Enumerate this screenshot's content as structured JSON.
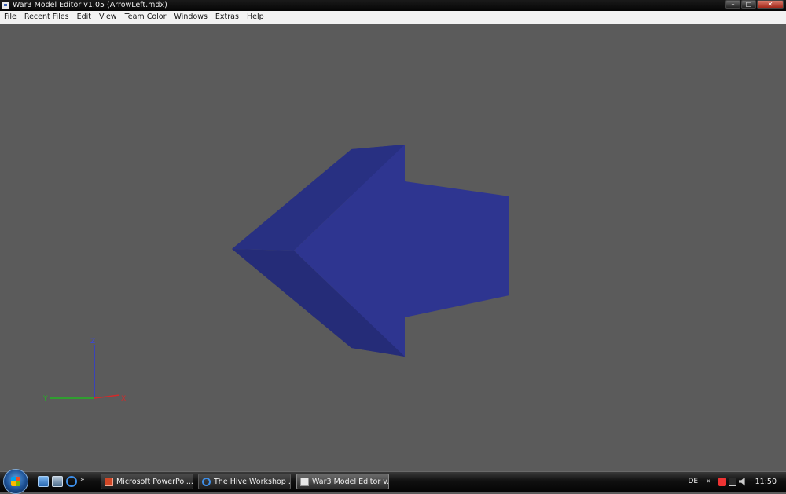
{
  "window": {
    "title": "War3 Model Editor v1.05 (ArrowLeft.mdx)",
    "buttons": {
      "minimize": "–",
      "maximize": "□",
      "close": "✕"
    }
  },
  "menu": {
    "items": [
      "File",
      "Recent Files",
      "Edit",
      "View",
      "Team Color",
      "Windows",
      "Extras",
      "Help"
    ]
  },
  "viewport": {
    "background": "#5b5b5b",
    "model_color": "#2e3590",
    "axes": {
      "z_label": "Z",
      "y_label": "Y",
      "x_label": "X",
      "z_color": "#2f3ad8",
      "y_color": "#22b522",
      "x_color": "#d42a2a"
    }
  },
  "taskbar": {
    "quicklaunch": [
      "show-desktop-icon",
      "switch-windows-icon",
      "internet-explorer-icon"
    ],
    "quicklaunch_more": "»",
    "tasks": [
      {
        "label": "Microsoft PowerPoi...",
        "icon": "powerpoint-icon",
        "active": false
      },
      {
        "label": "The Hive Workshop ...",
        "icon": "internet-explorer-icon",
        "active": false
      },
      {
        "label": "War3 Model Editor v...",
        "icon": "war3-model-editor-icon",
        "active": true
      }
    ],
    "tray": {
      "language": "DE",
      "expand": "«",
      "clock": "11:50"
    }
  }
}
